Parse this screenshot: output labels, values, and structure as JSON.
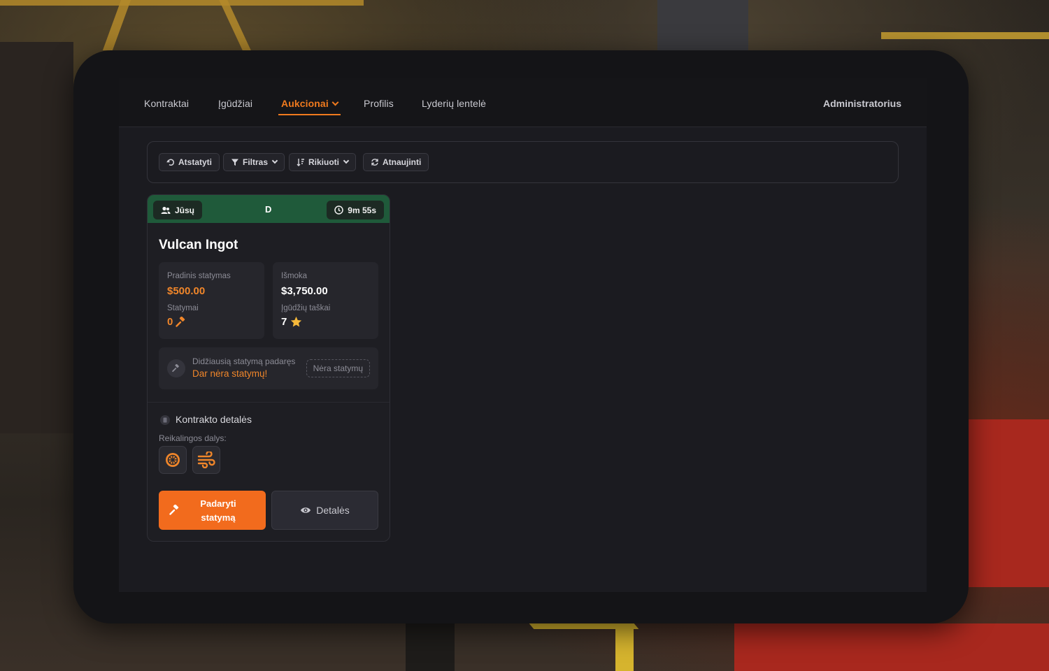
{
  "nav": {
    "items": [
      {
        "label": "Kontraktai"
      },
      {
        "label": "Įgūdžiai"
      },
      {
        "label": "Aukcionai"
      },
      {
        "label": "Profilis"
      },
      {
        "label": "Lyderių lentelė"
      }
    ],
    "active": "Aukcionai",
    "admin_label": "Administratorius"
  },
  "toolbar": {
    "reset_label": "Atstatyti",
    "filter_label": "Filtras",
    "sort_label": "Rikiuoti",
    "refresh_label": "Atnaujinti"
  },
  "auction_card": {
    "owner_label": "Jūsų",
    "grade": "D",
    "timer": "9m 55s",
    "title": "Vulcan Ingot",
    "starting_bid_label": "Pradinis statymas",
    "starting_bid_value": "$500.00",
    "bids_label": "Statymai",
    "bids_value": "0",
    "payout_label": "Išmoka",
    "payout_value": "$3,750.00",
    "skill_points_label": "Įgūdžių taškai",
    "skill_points_value": "7",
    "top_bidder_label": "Didžiausią statymą padaręs",
    "top_bidder_value": "Dar nėra statymų!",
    "no_bids_badge": "Nėra statymų",
    "details_title": "Kontrakto detalės",
    "required_parts_label": "Reikalingos dalys:",
    "parts": [
      "wheel-icon",
      "exhaust-wind-icon"
    ],
    "bid_button_label": "Padaryti statymą",
    "details_button_label": "Detalės"
  },
  "colors": {
    "accent": "#f07a1e",
    "card_header": "#1f5a3a"
  }
}
